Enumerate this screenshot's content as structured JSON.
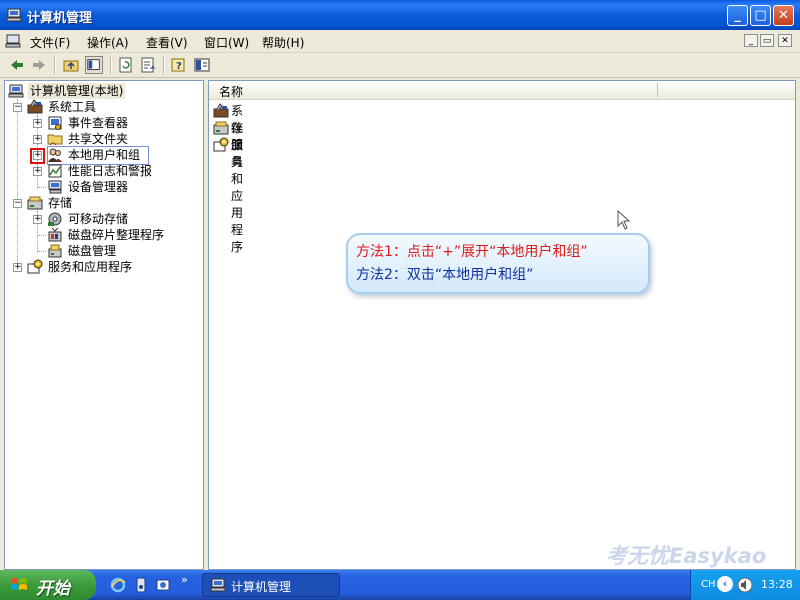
{
  "window": {
    "title": "计算机管理"
  },
  "menu": [
    "文件(F)",
    "操作(A)",
    "查看(V)",
    "窗口(W)",
    "帮助(H)"
  ],
  "mdi_controls": [
    "_",
    "▭",
    "✕"
  ],
  "toolbar": {
    "buttons": [
      "back-arrow-icon",
      "forward-arrow-icon",
      "up-folder-icon",
      "show-hide-tree-icon",
      "refresh-icon",
      "export-list-icon",
      "help-icon",
      "properties-icon"
    ]
  },
  "tree": {
    "root": "计算机管理(本地)",
    "system_tools": "系统工具",
    "event_viewer": "事件查看器",
    "shared_folders": "共享文件夹",
    "local_users": "本地用户和组",
    "performance_logs": "性能日志和警报",
    "device_manager": "设备管理器",
    "storage": "存储",
    "removable_storage": "可移动存储",
    "defrag": "磁盘碎片整理程序",
    "disk_mgmt": "磁盘管理",
    "services_apps": "服务和应用程序",
    "expand_symbol": "+",
    "collapse_symbol": "−"
  },
  "list": {
    "column_name": "名称",
    "items": [
      "系统工具",
      "存储",
      "服务和应用程序"
    ]
  },
  "callout": {
    "line1": "方法1：点击“+”展开“本地用户和组”",
    "line2": "方法2：双击“本地用户和组”",
    "line1_color": "#E01818",
    "line2_color": "#1030A0"
  },
  "watermark": "考无忧Easykao",
  "taskbar": {
    "start_label": "开始",
    "more": "»",
    "task_title": "计算机管理",
    "language": "CH",
    "clock": "13:28"
  }
}
